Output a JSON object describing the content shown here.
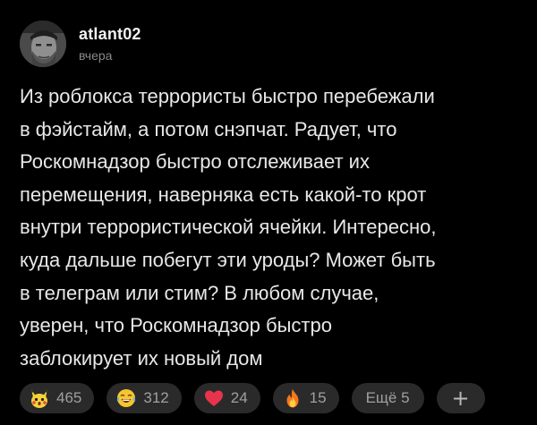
{
  "post": {
    "author": {
      "username": "atlant02",
      "time": "вчера"
    },
    "text": "Из роблокса террористы быстро перебежали\nв фэйстайм, а потом снэпчат. Радует, что\nРоскомнадзор быстро отслеживает их\nперемещения, наверняка есть какой-то крот\nвнутри террористической ячейки. Интересно,\nкуда дальше побегут эти уроды? Может быть\nв телеграм или стим? В любом случае,\nуверен, что Роскомнадзор быстро\nзаблокирует их новый дом",
    "reactions": [
      {
        "icon": "pikachu-face-icon",
        "count": "465"
      },
      {
        "icon": "laughing-tears-emoji-icon",
        "count": "312"
      },
      {
        "icon": "red-heart-icon",
        "count": "24"
      },
      {
        "icon": "fire-icon",
        "count": "15"
      }
    ],
    "more_label": "Ещё 5",
    "add_label": "+"
  },
  "colors": {
    "background": "#000000",
    "chip_background": "#2a2a2a",
    "text": "#e8e8e8",
    "muted_text": "#8a8a8a"
  }
}
